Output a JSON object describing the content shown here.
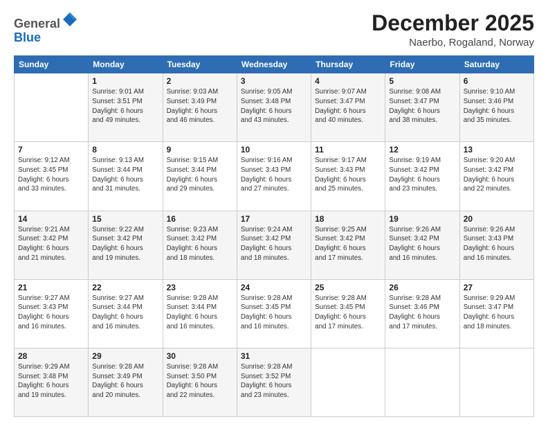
{
  "header": {
    "logo_general": "General",
    "logo_blue": "Blue",
    "month_title": "December 2025",
    "location": "Naerbo, Rogaland, Norway"
  },
  "weekdays": [
    "Sunday",
    "Monday",
    "Tuesday",
    "Wednesday",
    "Thursday",
    "Friday",
    "Saturday"
  ],
  "weeks": [
    [
      {
        "day": "",
        "info": ""
      },
      {
        "day": "1",
        "info": "Sunrise: 9:01 AM\nSunset: 3:51 PM\nDaylight: 6 hours\nand 49 minutes."
      },
      {
        "day": "2",
        "info": "Sunrise: 9:03 AM\nSunset: 3:49 PM\nDaylight: 6 hours\nand 46 minutes."
      },
      {
        "day": "3",
        "info": "Sunrise: 9:05 AM\nSunset: 3:48 PM\nDaylight: 6 hours\nand 43 minutes."
      },
      {
        "day": "4",
        "info": "Sunrise: 9:07 AM\nSunset: 3:47 PM\nDaylight: 6 hours\nand 40 minutes."
      },
      {
        "day": "5",
        "info": "Sunrise: 9:08 AM\nSunset: 3:47 PM\nDaylight: 6 hours\nand 38 minutes."
      },
      {
        "day": "6",
        "info": "Sunrise: 9:10 AM\nSunset: 3:46 PM\nDaylight: 6 hours\nand 35 minutes."
      }
    ],
    [
      {
        "day": "7",
        "info": "Sunrise: 9:12 AM\nSunset: 3:45 PM\nDaylight: 6 hours\nand 33 minutes."
      },
      {
        "day": "8",
        "info": "Sunrise: 9:13 AM\nSunset: 3:44 PM\nDaylight: 6 hours\nand 31 minutes."
      },
      {
        "day": "9",
        "info": "Sunrise: 9:15 AM\nSunset: 3:44 PM\nDaylight: 6 hours\nand 29 minutes."
      },
      {
        "day": "10",
        "info": "Sunrise: 9:16 AM\nSunset: 3:43 PM\nDaylight: 6 hours\nand 27 minutes."
      },
      {
        "day": "11",
        "info": "Sunrise: 9:17 AM\nSunset: 3:43 PM\nDaylight: 6 hours\nand 25 minutes."
      },
      {
        "day": "12",
        "info": "Sunrise: 9:19 AM\nSunset: 3:42 PM\nDaylight: 6 hours\nand 23 minutes."
      },
      {
        "day": "13",
        "info": "Sunrise: 9:20 AM\nSunset: 3:42 PM\nDaylight: 6 hours\nand 22 minutes."
      }
    ],
    [
      {
        "day": "14",
        "info": "Sunrise: 9:21 AM\nSunset: 3:42 PM\nDaylight: 6 hours\nand 21 minutes."
      },
      {
        "day": "15",
        "info": "Sunrise: 9:22 AM\nSunset: 3:42 PM\nDaylight: 6 hours\nand 19 minutes."
      },
      {
        "day": "16",
        "info": "Sunrise: 9:23 AM\nSunset: 3:42 PM\nDaylight: 6 hours\nand 18 minutes."
      },
      {
        "day": "17",
        "info": "Sunrise: 9:24 AM\nSunset: 3:42 PM\nDaylight: 6 hours\nand 18 minutes."
      },
      {
        "day": "18",
        "info": "Sunrise: 9:25 AM\nSunset: 3:42 PM\nDaylight: 6 hours\nand 17 minutes."
      },
      {
        "day": "19",
        "info": "Sunrise: 9:26 AM\nSunset: 3:42 PM\nDaylight: 6 hours\nand 16 minutes."
      },
      {
        "day": "20",
        "info": "Sunrise: 9:26 AM\nSunset: 3:43 PM\nDaylight: 6 hours\nand 16 minutes."
      }
    ],
    [
      {
        "day": "21",
        "info": "Sunrise: 9:27 AM\nSunset: 3:43 PM\nDaylight: 6 hours\nand 16 minutes."
      },
      {
        "day": "22",
        "info": "Sunrise: 9:27 AM\nSunset: 3:44 PM\nDaylight: 6 hours\nand 16 minutes."
      },
      {
        "day": "23",
        "info": "Sunrise: 9:28 AM\nSunset: 3:44 PM\nDaylight: 6 hours\nand 16 minutes."
      },
      {
        "day": "24",
        "info": "Sunrise: 9:28 AM\nSunset: 3:45 PM\nDaylight: 6 hours\nand 16 minutes."
      },
      {
        "day": "25",
        "info": "Sunrise: 9:28 AM\nSunset: 3:45 PM\nDaylight: 6 hours\nand 17 minutes."
      },
      {
        "day": "26",
        "info": "Sunrise: 9:28 AM\nSunset: 3:46 PM\nDaylight: 6 hours\nand 17 minutes."
      },
      {
        "day": "27",
        "info": "Sunrise: 9:29 AM\nSunset: 3:47 PM\nDaylight: 6 hours\nand 18 minutes."
      }
    ],
    [
      {
        "day": "28",
        "info": "Sunrise: 9:29 AM\nSunset: 3:48 PM\nDaylight: 6 hours\nand 19 minutes."
      },
      {
        "day": "29",
        "info": "Sunrise: 9:28 AM\nSunset: 3:49 PM\nDaylight: 6 hours\nand 20 minutes."
      },
      {
        "day": "30",
        "info": "Sunrise: 9:28 AM\nSunset: 3:50 PM\nDaylight: 6 hours\nand 22 minutes."
      },
      {
        "day": "31",
        "info": "Sunrise: 9:28 AM\nSunset: 3:52 PM\nDaylight: 6 hours\nand 23 minutes."
      },
      {
        "day": "",
        "info": ""
      },
      {
        "day": "",
        "info": ""
      },
      {
        "day": "",
        "info": ""
      }
    ]
  ]
}
